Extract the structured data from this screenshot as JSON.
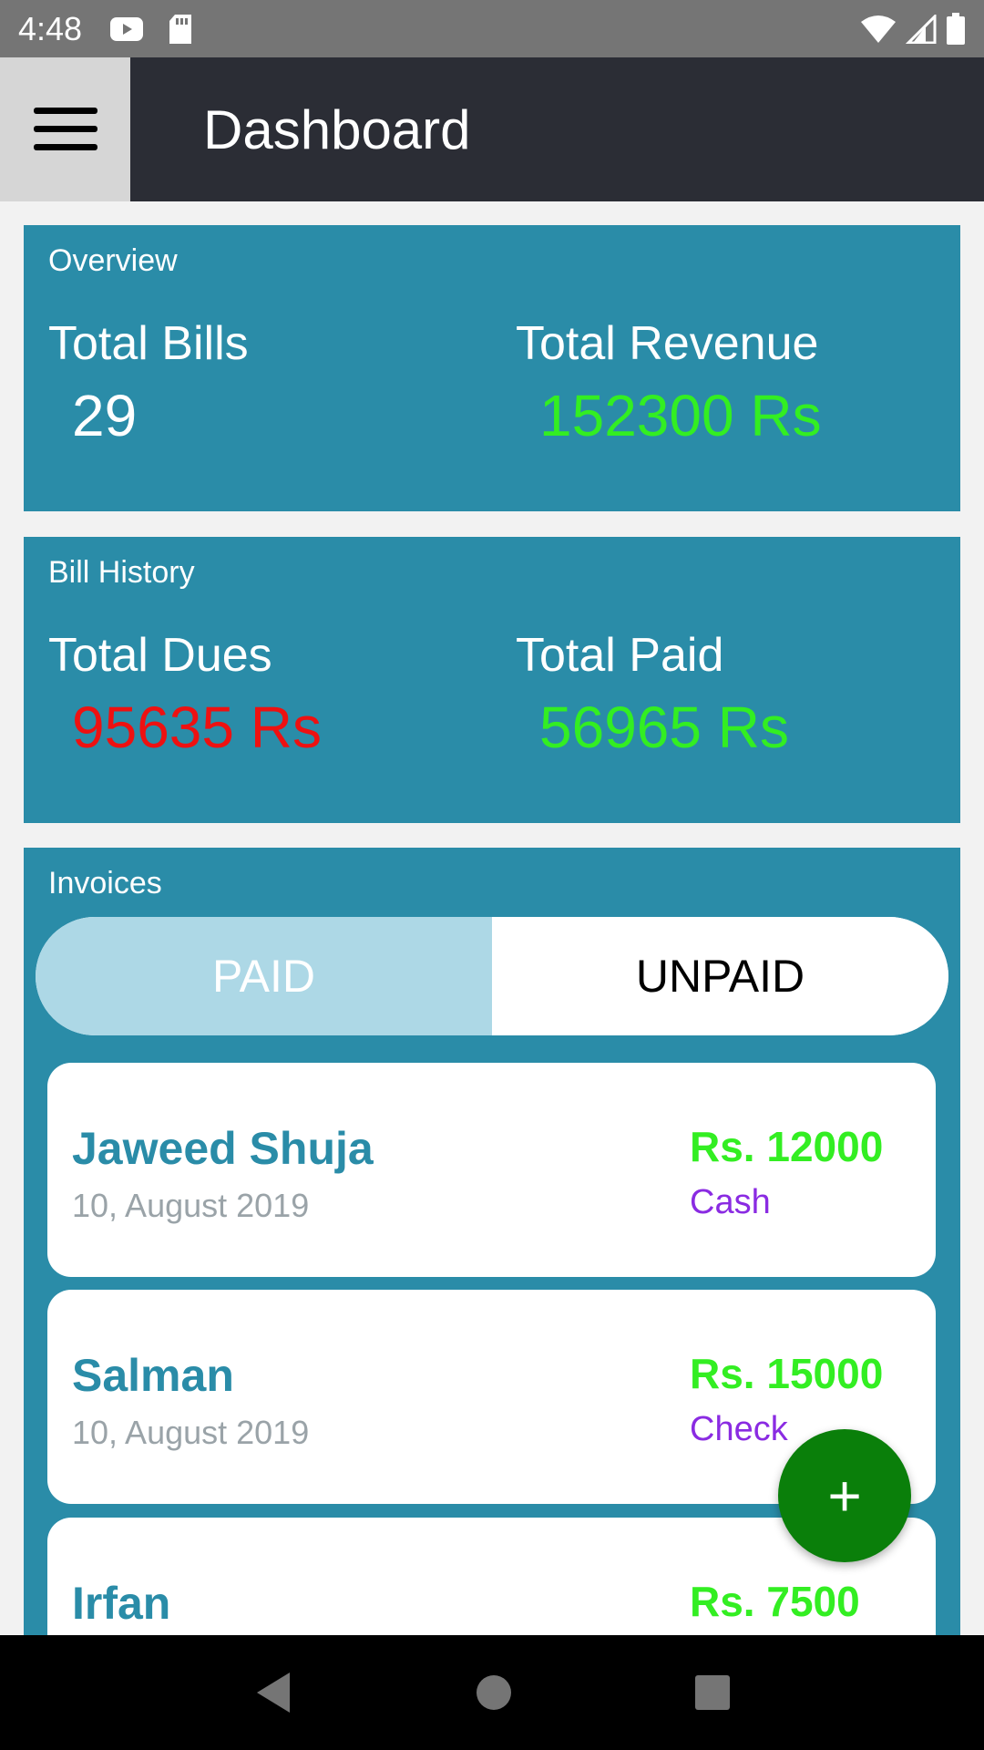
{
  "status_bar": {
    "time": "4:48"
  },
  "app_bar": {
    "title": "Dashboard"
  },
  "overview": {
    "heading": "Overview",
    "total_bills_label": "Total Bills",
    "total_bills_value": "29",
    "total_revenue_label": "Total Revenue",
    "total_revenue_value": "152300 Rs"
  },
  "bill_history": {
    "heading": "Bill History",
    "total_dues_label": "Total Dues",
    "total_dues_value": "95635 Rs",
    "total_paid_label": "Total Paid",
    "total_paid_value": "56965 Rs"
  },
  "invoices": {
    "heading": "Invoices",
    "tabs": [
      {
        "label": "PAID"
      },
      {
        "label": "UNPAID"
      }
    ],
    "items": [
      {
        "name": "Jaweed Shuja",
        "date": "10, August 2019",
        "amount": "Rs. 12000",
        "method": "Cash"
      },
      {
        "name": "Salman",
        "date": "10, August 2019",
        "amount": "Rs. 15000",
        "method": "Check"
      },
      {
        "name": "Irfan",
        "date": "",
        "amount": "Rs. 7500",
        "method": ""
      }
    ]
  },
  "fab": {
    "label": "+"
  },
  "colors": {
    "card_bg": "#2a8ca8",
    "positive": "#33ee22",
    "negative": "#ee1111",
    "method": "#8a2be2",
    "fab": "#0a7f0a"
  },
  "icons": {
    "menu": "hamburger-icon",
    "youtube": "youtube-icon",
    "sd_card": "sd-card-icon",
    "wifi": "wifi-icon",
    "signal": "signal-icon",
    "battery": "battery-icon",
    "back": "back-icon",
    "home": "home-icon",
    "recents": "recents-icon"
  }
}
